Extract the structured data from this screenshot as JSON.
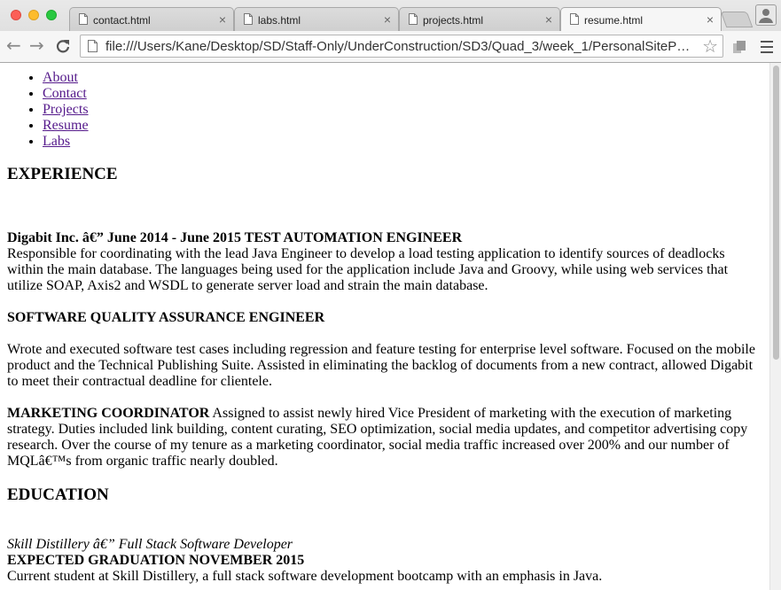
{
  "browser": {
    "tabs": [
      {
        "title": "contact.html",
        "active": false
      },
      {
        "title": "labs.html",
        "active": false
      },
      {
        "title": "projects.html",
        "active": false
      },
      {
        "title": "resume.html",
        "active": true
      }
    ],
    "close_glyph": "×",
    "url": "file:///Users/Kane/Desktop/SD/Staff-Only/UnderConstruction/SD3/Quad_3/week_1/PersonalSiteProj...",
    "icons": [
      "back-arrow-icon",
      "forward-arrow-icon",
      "reload-icon",
      "page-icon",
      "star-icon",
      "extension-icon",
      "menu-icon",
      "profile-icon"
    ],
    "back_glyph": "←",
    "forward_glyph": "→",
    "reload_glyph": "C",
    "star_glyph": "☆"
  },
  "nav": {
    "links": [
      "About",
      "Contact",
      "Projects",
      "Resume",
      "Labs"
    ]
  },
  "experience": {
    "heading": "EXPERIENCE",
    "job1": {
      "title_line": "Digabit Inc. â€” June 2014 - June 2015 TEST AUTOMATION ENGINEER",
      "description": "Responsible for coordinating with the lead Java Engineer to develop a load testing application to identify sources of deadlocks within the main database. The languages being used for the application include Java and Groovy, while using web services that utilize SOAP, Axis2 and WSDL to generate server load and strain the main database."
    },
    "job2": {
      "title_line": "SOFTWARE QUALITY ASSURANCE ENGINEER",
      "description": "Wrote and executed software test cases including regression and feature testing for enterprise level software. Focused on the mobile product and the Technical Publishing Suite. Assisted in eliminating the backlog of documents from a new contract, allowed Digabit to meet their contractual deadline for clientele."
    },
    "job3": {
      "title_line": "MARKETING COORDINATOR",
      "description": " Assigned to assist newly hired Vice President of marketing with the execution of marketing strategy. Duties included link building, content curating, SEO optimization, social media updates, and competitor advertising copy research. Over the course of my tenure as a marketing coordinator, social media traffic increased over 200% and our number of MQLâ€™s from organic traffic nearly doubled."
    }
  },
  "education": {
    "heading": "EDUCATION",
    "school_line": "Skill Distillery â€” Full Stack Software Developer",
    "graduation": "EXPECTED GRADUATION NOVEMBER 2015",
    "description": "Current student at Skill Distillery, a full stack software development bootcamp with an emphasis in Java."
  },
  "colors": {
    "link_visited": "#551a8b",
    "traffic_close": "#fc5f57",
    "traffic_min": "#fdbc2e",
    "traffic_max": "#28c840"
  }
}
